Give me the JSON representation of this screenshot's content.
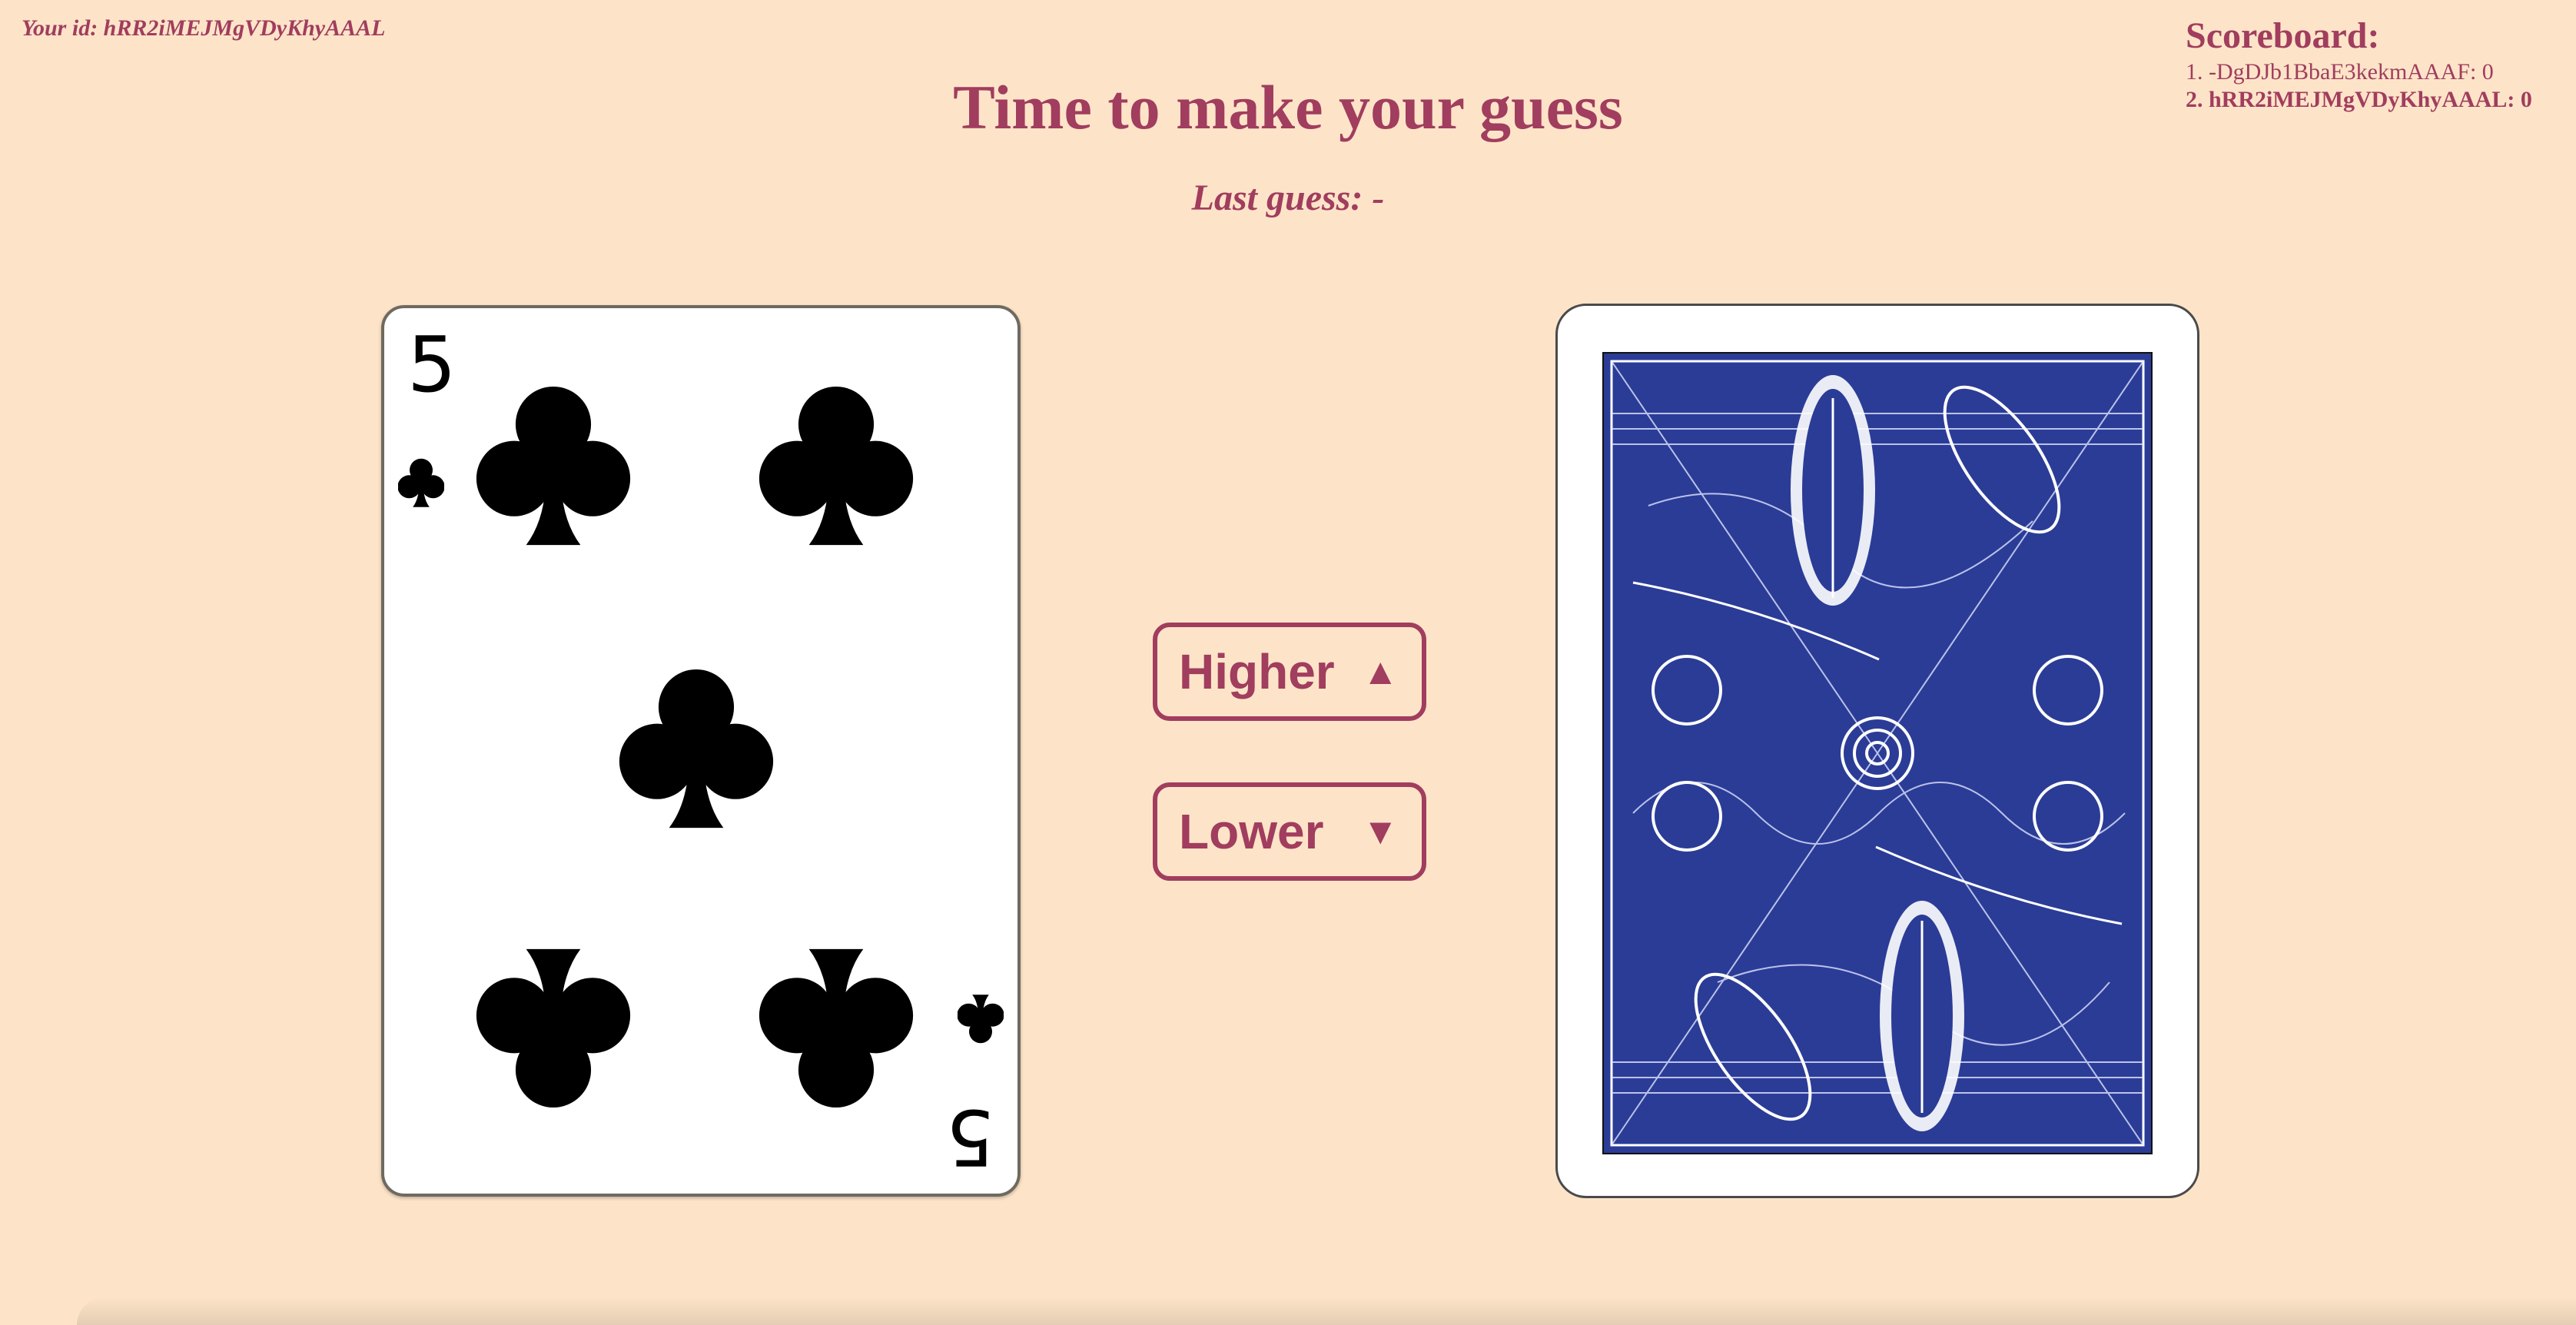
{
  "player": {
    "id_label": "Your id: hRR2iMEJMgVDyKhyAAAL"
  },
  "scoreboard": {
    "title": "Scoreboard:",
    "entries": [
      {
        "text": "1. -DgDJb1BbaE3kekmAAAF: 0",
        "current": false
      },
      {
        "text": "2. hRR2iMEJMgVDyKhyAAAL: 0",
        "current": true
      }
    ]
  },
  "game": {
    "title": "Time to make your guess",
    "last_guess": "Last guess: -"
  },
  "current_card": {
    "rank": "5",
    "suit": "clubs",
    "suit_icon": "club-icon",
    "color": "#000000"
  },
  "next_card": {
    "face_down": true,
    "back_color": "#2b3c97",
    "back_pattern": "white-rabbit-illustration"
  },
  "buttons": {
    "higher_label": "Higher",
    "higher_arrow": "▲",
    "lower_label": "Lower",
    "lower_arrow": "▼"
  },
  "colors": {
    "background": "#fde4c8",
    "accent": "#a13d5e"
  }
}
